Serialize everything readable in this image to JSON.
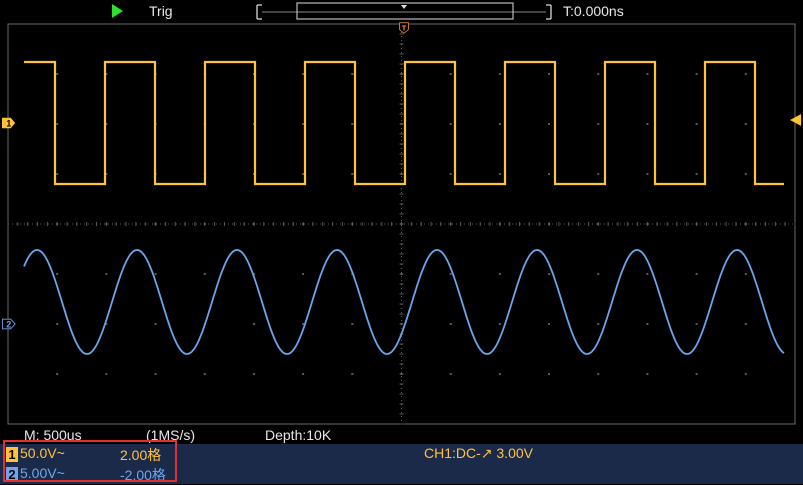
{
  "header": {
    "run_status": "running",
    "trig_label": "Trig",
    "time_position": "T:0.000ns"
  },
  "colors": {
    "ch1": "#ffc33b",
    "ch2": "#6aa6ec",
    "grid": "#5a5a5a",
    "highlight": "#e23030"
  },
  "markers": {
    "ch1": "1",
    "ch2": "2",
    "trigger": "T"
  },
  "bottom": {
    "timebase": "M: 500us",
    "sample_rate": "(1MS/s)",
    "depth": "Depth:10K"
  },
  "channels": [
    {
      "number": "1",
      "volts_div": "50.0V~",
      "offset": "2.00格"
    },
    {
      "number": "2",
      "volts_div": "5.00V~",
      "offset": "-2.00格"
    }
  ],
  "trigger_info": "CH1:DC-↗ 3.00V"
}
